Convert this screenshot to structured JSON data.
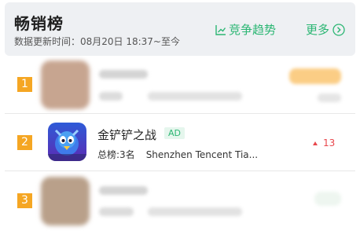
{
  "header": {
    "title": "畅销榜",
    "subtitle": "数据更新时间：08月20日 18:37~至今",
    "trend_label": "竞争趋势",
    "more_label": "更多"
  },
  "rows": [
    {
      "rank": "1"
    },
    {
      "rank": "2",
      "name": "金铲铲之战",
      "ad_label": "AD",
      "overall_rank": "总榜:3名",
      "developer": "Shenzhen Tencent Tia...",
      "change": "13",
      "change_direction": "up",
      "icon": "game-app-icon"
    },
    {
      "rank": "3"
    }
  ],
  "colors": {
    "accent": "#2bb673",
    "rank_badge": "#f5a623",
    "rise": "#e8474c"
  }
}
